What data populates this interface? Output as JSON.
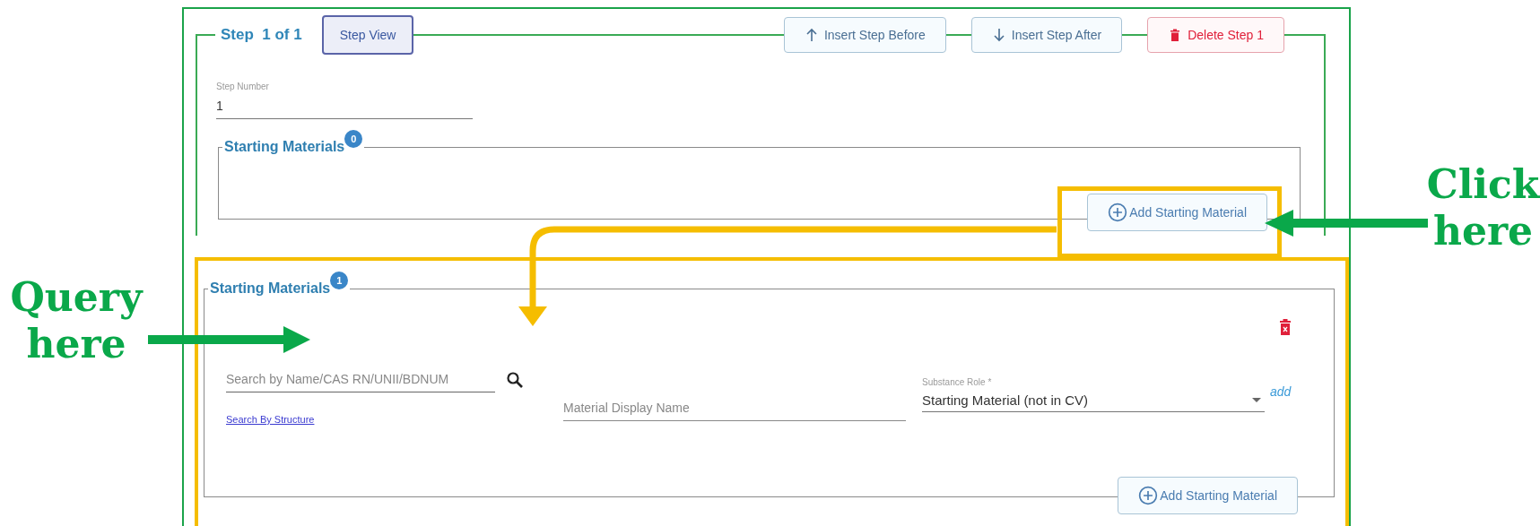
{
  "step": {
    "title": "Step  1 of 1",
    "view_button": "Step View",
    "actions": [
      {
        "label": "Insert Step Before",
        "kind": "up"
      },
      {
        "label": "Insert Step After",
        "kind": "down"
      },
      {
        "label": "Delete Step 1",
        "kind": "delete"
      }
    ]
  },
  "step_number": {
    "label": "Step Number",
    "value": "1"
  },
  "starting_materials_empty": {
    "title": "Starting Materials",
    "count": "0",
    "add_button": "Add Starting Material"
  },
  "starting_materials": {
    "title": "Starting Materials",
    "count": "1",
    "items": [
      {
        "search": {
          "placeholder": "Search by Name/CAS RN/UNII/BDNUM"
        },
        "structure_link": "Search By Structure",
        "display_name": {
          "placeholder": "Material Display Name"
        },
        "role": {
          "label": "Substance Role *",
          "value": "Starting Material (not in CV)"
        },
        "add_link": "add"
      }
    ],
    "add_button": "Add Starting Material"
  },
  "callouts": [
    {
      "lines": [
        "Click",
        "here"
      ]
    },
    {
      "lines": [
        "Query",
        "here"
      ]
    }
  ]
}
